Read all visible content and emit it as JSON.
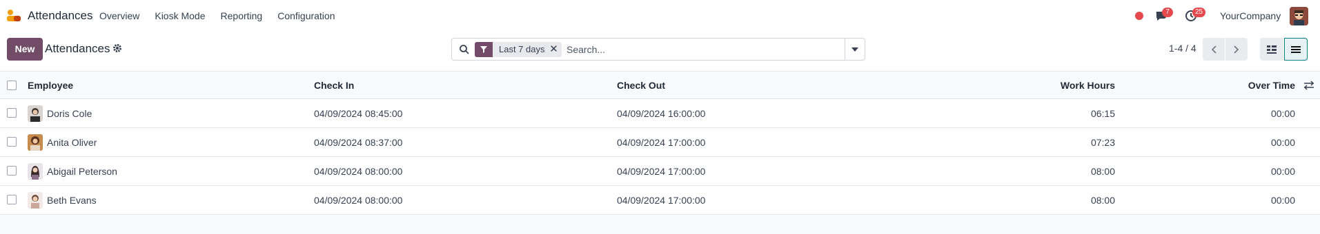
{
  "navbar": {
    "app_name": "Attendances",
    "menu": [
      "Overview",
      "Kiosk Mode",
      "Reporting",
      "Configuration"
    ],
    "messages_count": "7",
    "activities_count": "25",
    "company": "YourCompany",
    "status_color": "#e5484d"
  },
  "control_panel": {
    "new_label": "New",
    "title": "Attendances",
    "search": {
      "facet_label": "Last 7 days",
      "placeholder": "Search..."
    },
    "pager": "1-4 / 4"
  },
  "colors": {
    "brand": "#714b67",
    "active_view": "#017e84",
    "badge": "#e5484d"
  },
  "table": {
    "headers": {
      "employee": "Employee",
      "check_in": "Check In",
      "check_out": "Check Out",
      "work_hours": "Work Hours",
      "over_time": "Over Time"
    },
    "rows": [
      {
        "employee": "Doris Cole",
        "check_in": "04/09/2024 08:45:00",
        "check_out": "04/09/2024 16:00:00",
        "work_hours": "06:15",
        "over_time": "00:00"
      },
      {
        "employee": "Anita Oliver",
        "check_in": "04/09/2024 08:37:00",
        "check_out": "04/09/2024 17:00:00",
        "work_hours": "07:23",
        "over_time": "00:00"
      },
      {
        "employee": "Abigail Peterson",
        "check_in": "04/09/2024 08:00:00",
        "check_out": "04/09/2024 17:00:00",
        "work_hours": "08:00",
        "over_time": "00:00"
      },
      {
        "employee": "Beth Evans",
        "check_in": "04/09/2024 08:00:00",
        "check_out": "04/09/2024 17:00:00",
        "work_hours": "08:00",
        "over_time": "00:00"
      }
    ]
  }
}
